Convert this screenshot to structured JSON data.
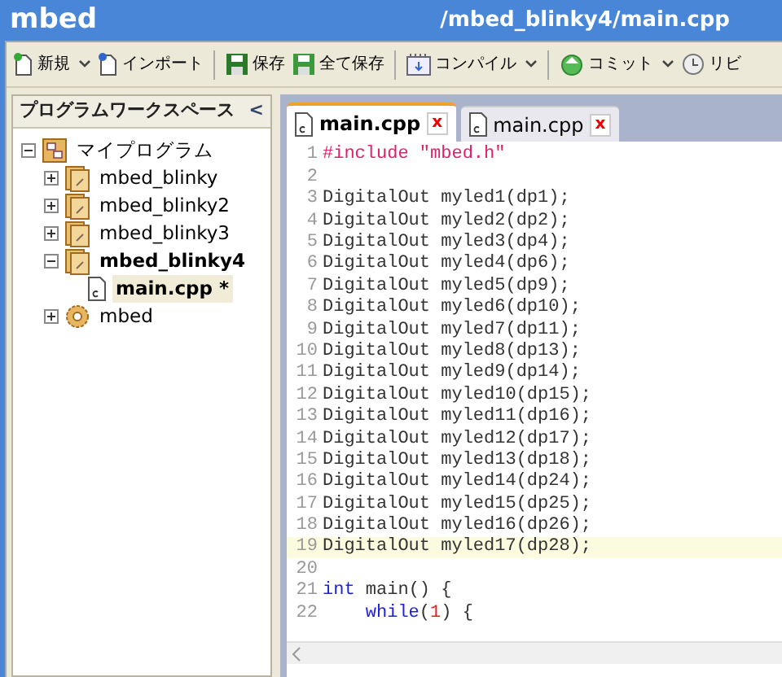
{
  "header": {
    "logo": "mbed",
    "path": "/mbed_blinky4/main.cpp"
  },
  "toolbar_groups": [
    [
      {
        "kind": "new",
        "label": "新規",
        "dropdown": true
      },
      {
        "kind": "import",
        "label": "インポート",
        "dropdown": false
      }
    ],
    [
      {
        "kind": "save",
        "label": "保存",
        "dropdown": false
      },
      {
        "kind": "save_all",
        "label": "全て保存",
        "dropdown": false
      }
    ],
    [
      {
        "kind": "compile",
        "label": "コンパイル",
        "dropdown": true
      }
    ],
    [
      {
        "kind": "commit",
        "label": "コミット",
        "dropdown": true
      },
      {
        "kind": "revision",
        "label": "リビ"
      }
    ]
  ],
  "sidebar": {
    "title": "プログラムワークスペース",
    "collapse": "<",
    "tree": [
      {
        "kind": "workspace",
        "label": "マイプログラム",
        "expanded": true,
        "bold": false,
        "selected": false,
        "children": [
          {
            "kind": "program",
            "label": "mbed_blinky",
            "expanded": false,
            "bold": false,
            "selected": false
          },
          {
            "kind": "program",
            "label": "mbed_blinky2",
            "expanded": false,
            "bold": false,
            "selected": false
          },
          {
            "kind": "program",
            "label": "mbed_blinky3",
            "expanded": false,
            "bold": false,
            "selected": false
          },
          {
            "kind": "program",
            "label": "mbed_blinky4",
            "expanded": true,
            "bold": true,
            "selected": false,
            "children": [
              {
                "kind": "file",
                "label": "main.cpp *",
                "bold": true,
                "selected": true
              }
            ]
          },
          {
            "kind": "library",
            "label": "mbed",
            "expanded": false,
            "bold": false,
            "selected": false
          }
        ]
      }
    ]
  },
  "editor": {
    "tabs": [
      {
        "label": "main.cpp",
        "selected": true,
        "close": "x"
      },
      {
        "label": "main.cpp",
        "selected": false,
        "close": "x"
      }
    ],
    "lines": [
      {
        "number": "1",
        "current": false,
        "tokens": [
          {
            "kind": "preprocessor",
            "text": "#include "
          },
          {
            "kind": "string",
            "text": "\"mbed.h\""
          }
        ]
      },
      {
        "number": "2",
        "current": false
      },
      {
        "number": "3",
        "current": false,
        "tokens": [
          {
            "kind": "plain",
            "text": "DigitalOut myled1(dp1);"
          }
        ]
      },
      {
        "number": "4",
        "current": false,
        "tokens": [
          {
            "kind": "plain",
            "text": "DigitalOut myled2(dp2);"
          }
        ]
      },
      {
        "number": "5",
        "current": false,
        "tokens": [
          {
            "kind": "plain",
            "text": "DigitalOut myled3(dp4);"
          }
        ]
      },
      {
        "number": "6",
        "current": false,
        "tokens": [
          {
            "kind": "plain",
            "text": "DigitalOut myled4(dp6);"
          }
        ]
      },
      {
        "number": "7",
        "current": false,
        "tokens": [
          {
            "kind": "plain",
            "text": "DigitalOut myled5(dp9);"
          }
        ]
      },
      {
        "number": "8",
        "current": false,
        "tokens": [
          {
            "kind": "plain",
            "text": "DigitalOut myled6(dp10);"
          }
        ]
      },
      {
        "number": "9",
        "current": false,
        "tokens": [
          {
            "kind": "plain",
            "text": "DigitalOut myled7(dp11);"
          }
        ]
      },
      {
        "number": "10",
        "current": false,
        "tokens": [
          {
            "kind": "plain",
            "text": "DigitalOut myled8(dp13);"
          }
        ]
      },
      {
        "number": "11",
        "current": false,
        "tokens": [
          {
            "kind": "plain",
            "text": "DigitalOut myled9(dp14);"
          }
        ]
      },
      {
        "number": "12",
        "current": false,
        "tokens": [
          {
            "kind": "plain",
            "text": "DigitalOut myled10(dp15);"
          }
        ]
      },
      {
        "number": "13",
        "current": false,
        "tokens": [
          {
            "kind": "plain",
            "text": "DigitalOut myled11(dp16);"
          }
        ]
      },
      {
        "number": "14",
        "current": false,
        "tokens": [
          {
            "kind": "plain",
            "text": "DigitalOut myled12(dp17);"
          }
        ]
      },
      {
        "number": "15",
        "current": false,
        "tokens": [
          {
            "kind": "plain",
            "text": "DigitalOut myled13(dp18);"
          }
        ]
      },
      {
        "number": "16",
        "current": false,
        "tokens": [
          {
            "kind": "plain",
            "text": "DigitalOut myled14(dp24);"
          }
        ]
      },
      {
        "number": "17",
        "current": false,
        "tokens": [
          {
            "kind": "plain",
            "text": "DigitalOut myled15(dp25);"
          }
        ]
      },
      {
        "number": "18",
        "current": false,
        "tokens": [
          {
            "kind": "plain",
            "text": "DigitalOut myled16(dp26);"
          }
        ]
      },
      {
        "number": "19",
        "current": true,
        "tokens": [
          {
            "kind": "plain",
            "text": "DigitalOut myled17(dp28);"
          }
        ]
      },
      {
        "number": "20",
        "current": false
      },
      {
        "number": "21",
        "current": false,
        "tokens": [
          {
            "kind": "keyword",
            "text": "int"
          },
          {
            "kind": "plain",
            "text": " main() {"
          }
        ]
      },
      {
        "number": "22",
        "current": false,
        "indent": true,
        "tokens": [
          {
            "kind": "keyword",
            "text": "while"
          },
          {
            "kind": "plain",
            "text": "("
          },
          {
            "kind": "number",
            "text": "1"
          },
          {
            "kind": "plain",
            "text": ") {"
          }
        ]
      }
    ]
  }
}
